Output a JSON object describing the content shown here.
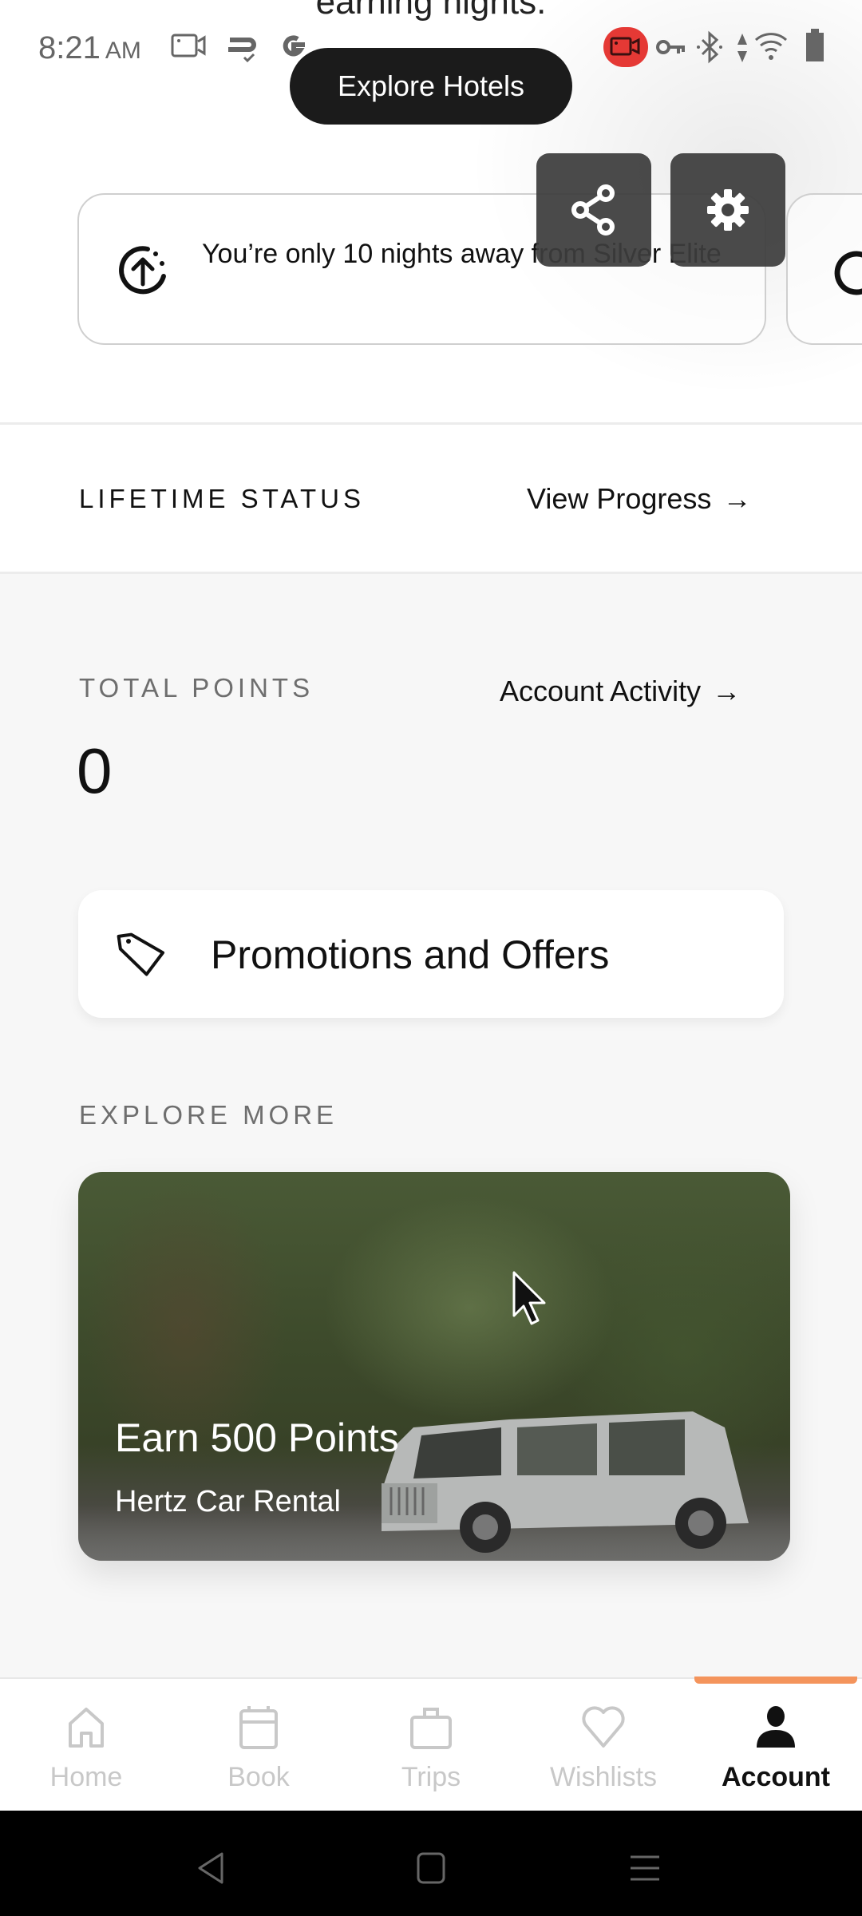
{
  "background_text": "earning nights.",
  "status_bar": {
    "time": "8:21",
    "ampm": "AM",
    "left_icons": [
      "screen-record-icon",
      "transfer-icon",
      "google-icon"
    ],
    "right_icons": [
      "recording-badge-icon",
      "vpn-key-icon",
      "bluetooth-icon",
      "data-arrows-icon",
      "wifi-icon",
      "battery-icon"
    ],
    "recording_color": "#e53935"
  },
  "floating_button": {
    "label": "Explore Hotels"
  },
  "toolbar": {
    "share_icon": "share-icon",
    "settings_icon": "gear-icon"
  },
  "status_nudge": {
    "icon": "upgrade-progress-icon",
    "text": "You’re only 10 nights away from Silver Elite"
  },
  "next_card": {
    "icon": "refresh-icon"
  },
  "lifetime": {
    "label": "LIFETIME STATUS",
    "link": "View Progress",
    "arrow": "→"
  },
  "points": {
    "label": "TOTAL POINTS",
    "value": "0",
    "link": "Account Activity",
    "arrow": "→"
  },
  "promotions": {
    "icon": "tag-icon",
    "label": "Promotions and Offers"
  },
  "explore": {
    "label": "EXPLORE MORE",
    "cards": [
      {
        "title": "Earn 500 Points",
        "subtitle": "Hertz Car Rental"
      }
    ]
  },
  "bottom_nav": {
    "active_color": "#f4945c",
    "items": [
      {
        "label": "Home",
        "icon": "home-icon",
        "active": false
      },
      {
        "label": "Book",
        "icon": "calendar-icon",
        "active": false
      },
      {
        "label": "Trips",
        "icon": "suitcase-icon",
        "active": false
      },
      {
        "label": "Wishlists",
        "icon": "heart-icon",
        "active": false
      },
      {
        "label": "Account",
        "icon": "person-icon",
        "active": true
      }
    ]
  },
  "system_nav": [
    "back-icon",
    "home-square-icon",
    "recents-icon"
  ]
}
